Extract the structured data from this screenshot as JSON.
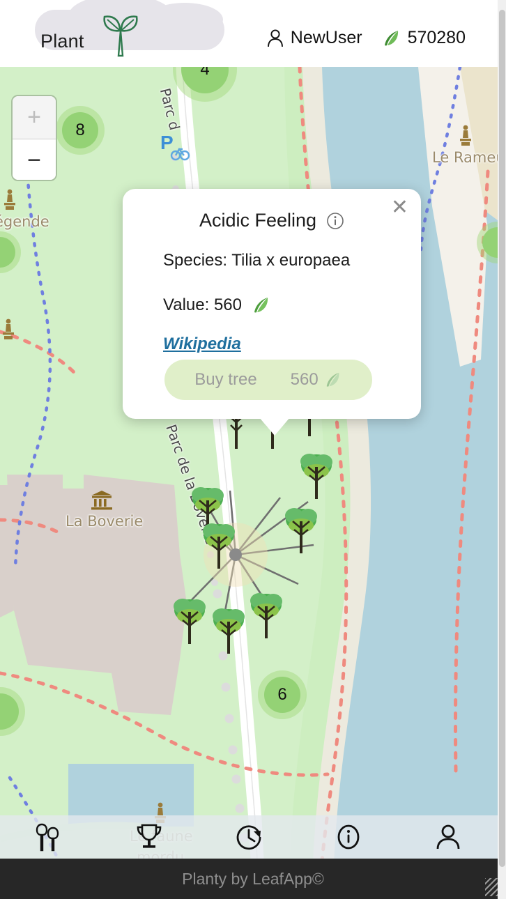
{
  "header": {
    "logo_text": "Plant",
    "logo_icon": "sprout-leaf-icon",
    "user_icon": "person-icon",
    "user_name": "NewUser",
    "coin_icon": "leaf-icon",
    "coin_amount": "570280"
  },
  "map": {
    "zoom_in_label": "+",
    "zoom_out_label": "−",
    "clusters": [
      {
        "count": "4"
      },
      {
        "count": "8"
      },
      {
        "count": "6"
      },
      {
        "count": "6"
      }
    ],
    "labels": [
      {
        "text": "Le Rameur",
        "icon": "statue-icon"
      },
      {
        "text": "égende",
        "icon": "statue-icon"
      },
      {
        "text": "La Boverie",
        "icon": "museum-icon"
      },
      {
        "text": "Parc de la Boverie",
        "icon": "path-label"
      },
      {
        "text": "Parc d",
        "icon": "path-label"
      },
      {
        "text": "Le faune",
        "icon": "statue-icon"
      },
      {
        "text": "mordu",
        "icon": "statue-icon"
      }
    ],
    "parking_icon": "bicycle-parking-icon",
    "colors": {
      "park": "#d3f0c8",
      "water": "#b0d2dd",
      "building": "#d9d0cb",
      "path": "#f2f0eb",
      "cluster": "#94d275",
      "footway": "#ef8a7f"
    }
  },
  "popup": {
    "title": "Acidic Feeling",
    "info_icon": "info-circle-icon",
    "close_icon": "close-icon",
    "species_label": "Species: Tilia x europaea",
    "value_label": "Value: 560",
    "value_icon": "leaf-icon",
    "wikipedia_link": "Wikipedia",
    "buy_label": "Buy tree",
    "buy_cost": "560",
    "buy_icon": "leaf-icon"
  },
  "bottom_nav": [
    {
      "name": "trees-icon",
      "label": "Trees"
    },
    {
      "name": "trophy-icon",
      "label": "Leaderboard"
    },
    {
      "name": "history-icon",
      "label": "History"
    },
    {
      "name": "info-icon",
      "label": "Info"
    },
    {
      "name": "account-icon",
      "label": "Account"
    }
  ],
  "footer": {
    "text": "Planty by LeafApp©"
  }
}
